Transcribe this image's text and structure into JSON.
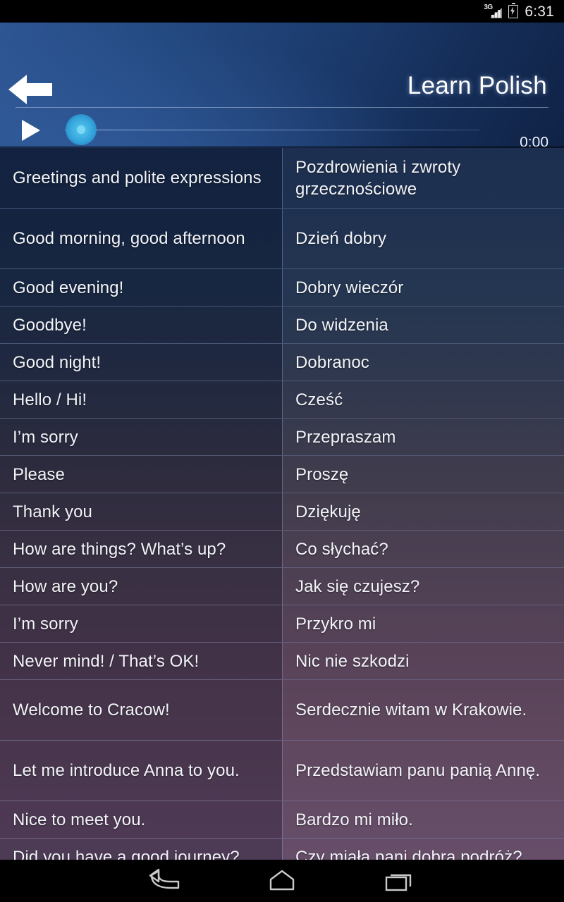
{
  "status_bar": {
    "network_label": "3G",
    "signal_icon": "signal-bars-icon",
    "battery_icon": "battery-charging-icon",
    "time": "6:31"
  },
  "header": {
    "back_icon": "back-arrow-icon",
    "title": "Learn Polish"
  },
  "player": {
    "play_icon": "play-icon",
    "seek_thumb_icon": "seek-thumb",
    "current_time": "0:00",
    "progress_percent": 0,
    "accent_color": "#3fb0e2"
  },
  "table": {
    "rows": [
      {
        "en": "Greetings and polite expressions",
        "pl": "Pozdrowienia i zwroty grzecznościowe",
        "lines": 2
      },
      {
        "en": "Good morning, good afternoon",
        "pl": "Dzień dobry",
        "lines": 2
      },
      {
        "en": "Good evening!",
        "pl": "Dobry wieczór",
        "lines": 1
      },
      {
        "en": "Goodbye!",
        "pl": "Do widzenia",
        "lines": 1
      },
      {
        "en": "Good night!",
        "pl": "Dobranoc",
        "lines": 1
      },
      {
        "en": "Hello / Hi!",
        "pl": "Cześć",
        "lines": 1
      },
      {
        "en": "I’m sorry",
        "pl": "Przepraszam",
        "lines": 1
      },
      {
        "en": "Please",
        "pl": "Proszę",
        "lines": 1
      },
      {
        "en": "Thank you",
        "pl": "Dziękuję",
        "lines": 1
      },
      {
        "en": "How are things? What’s up?",
        "pl": "Co słychać?",
        "lines": 1
      },
      {
        "en": "How are you?",
        "pl": "Jak się czujesz?",
        "lines": 1
      },
      {
        "en": "I’m sorry",
        "pl": "Przykro mi",
        "lines": 1
      },
      {
        "en": "Never mind! / That’s OK!",
        "pl": "Nic nie szkodzi",
        "lines": 1
      },
      {
        "en": "Welcome to Cracow!",
        "pl": "Serdecznie witam w Krakowie.",
        "lines": 2
      },
      {
        "en": "Let me introduce Anna to you.",
        "pl": "Przedstawiam panu panią Annę.",
        "lines": 2
      },
      {
        "en": "Nice to meet you.",
        "pl": "Bardzo mi miło.",
        "lines": 1
      },
      {
        "en": "Did you have a good journey?",
        "pl": "Czy miała pani dobrą podróż?",
        "lines": 1
      }
    ]
  },
  "navigation_bar": {
    "buttons": [
      {
        "name": "back",
        "icon": "nav-back-icon"
      },
      {
        "name": "home",
        "icon": "nav-home-icon"
      },
      {
        "name": "recents",
        "icon": "nav-recents-icon"
      }
    ]
  }
}
